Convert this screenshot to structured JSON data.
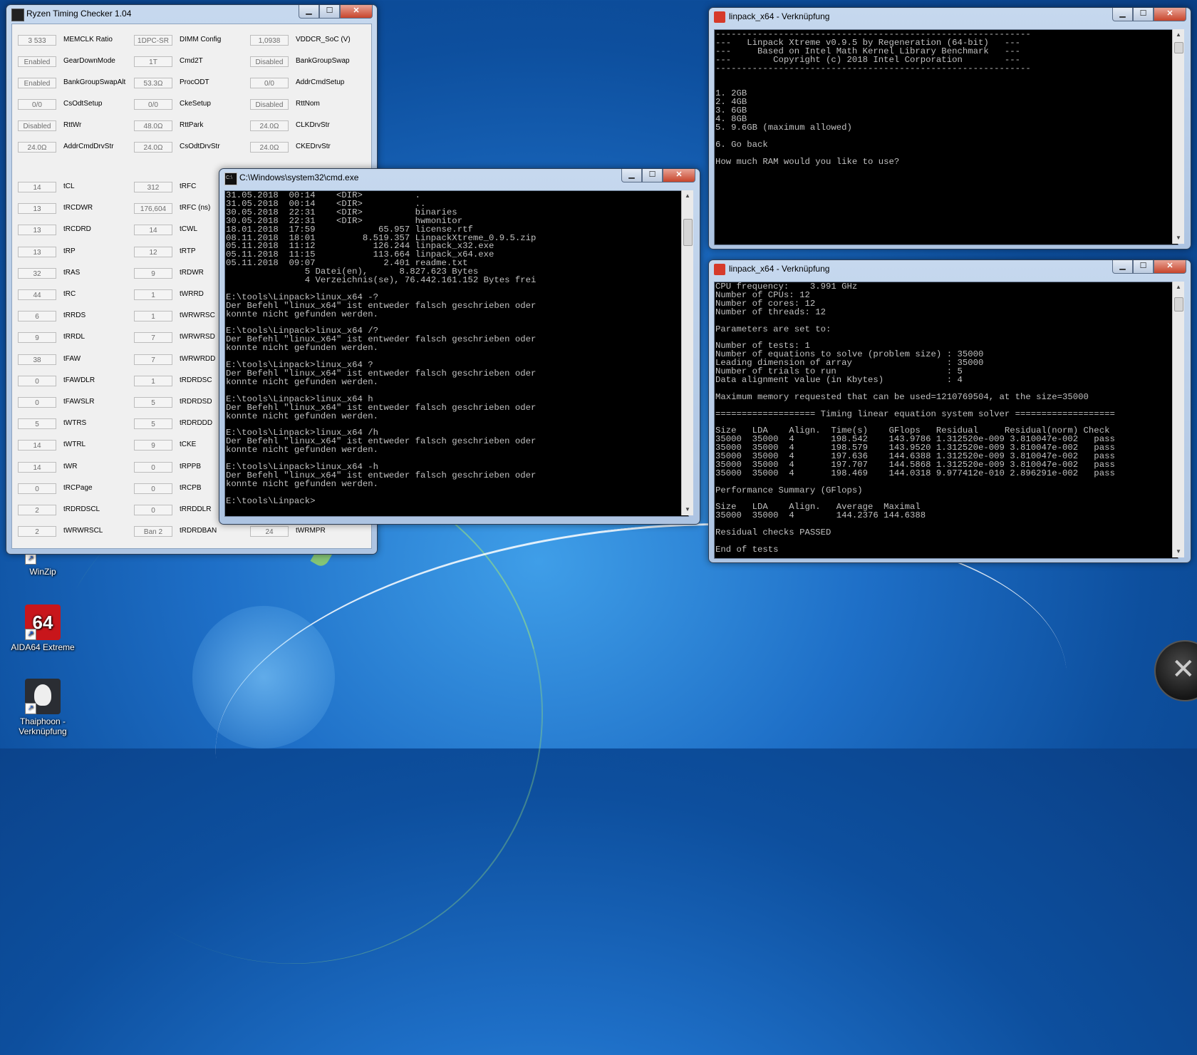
{
  "desktop": {
    "icons": [
      {
        "label": "WinZip"
      },
      {
        "label": "AIDA64 Extreme",
        "badge": "64"
      },
      {
        "label": "Thaiphoon - Verknüpfung"
      }
    ]
  },
  "rtc": {
    "title": "Ryzen Timing Checker 1.04",
    "top_fields": [
      {
        "value": "3 533",
        "label": "MEMCLK Ratio"
      },
      {
        "value": "1DPC-SR",
        "label": "DIMM Config"
      },
      {
        "value": "1,0938",
        "label": "VDDCR_SoC (V)"
      },
      {
        "value": "Enabled",
        "label": "GearDownMode"
      },
      {
        "value": "1T",
        "label": "Cmd2T"
      },
      {
        "value": "Disabled",
        "label": "BankGroupSwap"
      },
      {
        "value": "Enabled",
        "label": "BankGroupSwapAlt"
      },
      {
        "value": "53.3Ω",
        "label": "ProcODT"
      },
      {
        "value": "0/0",
        "label": "AddrCmdSetup"
      },
      {
        "value": "0/0",
        "label": "CsOdtSetup"
      },
      {
        "value": "0/0",
        "label": "CkeSetup"
      },
      {
        "value": "Disabled",
        "label": "RttNom"
      },
      {
        "value": "Disabled",
        "label": "RttWr"
      },
      {
        "value": "48.0Ω",
        "label": "RttPark"
      },
      {
        "value": "24.0Ω",
        "label": "CLKDrvStr"
      },
      {
        "value": "24.0Ω",
        "label": "AddrCmdDrvStr"
      },
      {
        "value": "24.0Ω",
        "label": "CsOdtDrvStr"
      },
      {
        "value": "24.0Ω",
        "label": "CKEDrvStr"
      }
    ],
    "col1": [
      {
        "value": "14",
        "label": "tCL"
      },
      {
        "value": "13",
        "label": "tRCDWR"
      },
      {
        "value": "13",
        "label": "tRCDRD"
      },
      {
        "value": "13",
        "label": "tRP"
      },
      {
        "value": "32",
        "label": "tRAS"
      },
      {
        "value": "44",
        "label": "tRC"
      },
      {
        "value": "6",
        "label": "tRRDS"
      },
      {
        "value": "9",
        "label": "tRRDL"
      },
      {
        "value": "38",
        "label": "tFAW"
      },
      {
        "value": "0",
        "label": "tFAWDLR"
      },
      {
        "value": "0",
        "label": "tFAWSLR"
      },
      {
        "value": "5",
        "label": "tWTRS"
      },
      {
        "value": "14",
        "label": "tWTRL"
      },
      {
        "value": "14",
        "label": "tWR"
      },
      {
        "value": "0",
        "label": "tRCPage"
      },
      {
        "value": "2",
        "label": "tRDRDSCL"
      },
      {
        "value": "2",
        "label": "tWRWRSCL"
      }
    ],
    "col2": [
      {
        "value": "312",
        "label": "tRFC"
      },
      {
        "value": "176,604",
        "label": "tRFC (ns)"
      },
      {
        "value": "14",
        "label": "tCWL"
      },
      {
        "value": "12",
        "label": "tRTP"
      },
      {
        "value": "9",
        "label": "tRDWR"
      },
      {
        "value": "1",
        "label": "tWRRD"
      },
      {
        "value": "1",
        "label": "tWRWRSC"
      },
      {
        "value": "7",
        "label": "tWRWRSD"
      },
      {
        "value": "7",
        "label": "tWRWRDD"
      },
      {
        "value": "1",
        "label": "tRDRDSC"
      },
      {
        "value": "5",
        "label": "tRDRDSD"
      },
      {
        "value": "5",
        "label": "tRDRDDD"
      },
      {
        "value": "9",
        "label": "tCKE"
      },
      {
        "value": "0",
        "label": "tRPPB"
      },
      {
        "value": "0",
        "label": "tRCPB"
      },
      {
        "value": "0",
        "label": "tRRDDLR"
      },
      {
        "value": "Ban 2",
        "label": "tRDRDBAN"
      }
    ],
    "col3": [
      {
        "value": "24",
        "label": "tWRMPR"
      }
    ]
  },
  "cmd": {
    "title": "C:\\Windows\\system32\\cmd.exe",
    "lines": [
      "31.05.2018  00:14    <DIR>          .",
      "31.05.2018  00:14    <DIR>          ..",
      "30.05.2018  22:31    <DIR>          binaries",
      "30.05.2018  22:31    <DIR>          hwmonitor",
      "18.01.2018  17:59            65.957 license.rtf",
      "08.11.2018  18:01         8.519.357 LinpackXtreme_0.9.5.zip",
      "05.11.2018  11:12           126.244 linpack_x32.exe",
      "05.11.2018  11:15           113.664 linpack_x64.exe",
      "05.11.2018  09:07             2.401 readme.txt",
      "               5 Datei(en),      8.827.623 Bytes",
      "               4 Verzeichnis(se), 76.442.161.152 Bytes frei",
      "",
      "E:\\tools\\Linpack>linux_x64 -?",
      "Der Befehl \"linux_x64\" ist entweder falsch geschrieben oder",
      "konnte nicht gefunden werden.",
      "",
      "E:\\tools\\Linpack>linux_x64 /?",
      "Der Befehl \"linux_x64\" ist entweder falsch geschrieben oder",
      "konnte nicht gefunden werden.",
      "",
      "E:\\tools\\Linpack>linux_x64 ?",
      "Der Befehl \"linux_x64\" ist entweder falsch geschrieben oder",
      "konnte nicht gefunden werden.",
      "",
      "E:\\tools\\Linpack>linux_x64 h",
      "Der Befehl \"linux_x64\" ist entweder falsch geschrieben oder",
      "konnte nicht gefunden werden.",
      "",
      "E:\\tools\\Linpack>linux_x64 /h",
      "Der Befehl \"linux_x64\" ist entweder falsch geschrieben oder",
      "konnte nicht gefunden werden.",
      "",
      "E:\\tools\\Linpack>linux_x64 -h",
      "Der Befehl \"linux_x64\" ist entweder falsch geschrieben oder",
      "konnte nicht gefunden werden.",
      "",
      "E:\\tools\\Linpack>"
    ]
  },
  "linpack_top": {
    "title": "linpack_x64 - Verknüpfung",
    "lines": [
      "------------------------------------------------------------",
      "---   Linpack Xtreme v0.9.5 by Regeneration (64-bit)   ---",
      "---     Based on Intel Math Kernel Library Benchmark   ---",
      "---        Copyright (c) 2018 Intel Corporation        ---",
      "------------------------------------------------------------",
      "",
      "",
      "1. 2GB",
      "2. 4GB",
      "3. 6GB",
      "4. 8GB",
      "5. 9.6GB (maximum allowed)",
      "",
      "6. Go back",
      "",
      "How much RAM would you like to use?"
    ]
  },
  "linpack_bottom": {
    "title": "linpack_x64 - Verknüpfung",
    "lines": [
      "CPU frequency:    3.991 GHz",
      "Number of CPUs: 12",
      "Number of cores: 12",
      "Number of threads: 12",
      "",
      "Parameters are set to:",
      "",
      "Number of tests: 1",
      "Number of equations to solve (problem size) : 35000",
      "Leading dimension of array                  : 35000",
      "Number of trials to run                     : 5",
      "Data alignment value (in Kbytes)            : 4",
      "",
      "Maximum memory requested that can be used=1210769504, at the size=35000",
      "",
      "=================== Timing linear equation system solver ===================",
      "",
      "Size   LDA    Align.  Time(s)    GFlops   Residual     Residual(norm) Check",
      "35000  35000  4       198.542    143.9786 1.312520e-009 3.810047e-002   pass",
      "35000  35000  4       198.579    143.9520 1.312520e-009 3.810047e-002   pass",
      "35000  35000  4       197.636    144.6388 1.312520e-009 3.810047e-002   pass",
      "35000  35000  4       197.707    144.5868 1.312520e-009 3.810047e-002   pass",
      "35000  35000  4       198.469    144.0318 9.977412e-010 2.896291e-002   pass",
      "",
      "Performance Summary (GFlops)",
      "",
      "Size   LDA    Align.   Average  Maximal",
      "35000  35000  4        144.2376 144.6388",
      "",
      "Residual checks PASSED",
      "",
      "End of tests"
    ]
  },
  "controls": {
    "min": "▁",
    "max": "☐",
    "close": "✕"
  },
  "scroll": {
    "up": "▲",
    "down": "▼"
  },
  "start_orb": {
    "glyph": "✕"
  }
}
